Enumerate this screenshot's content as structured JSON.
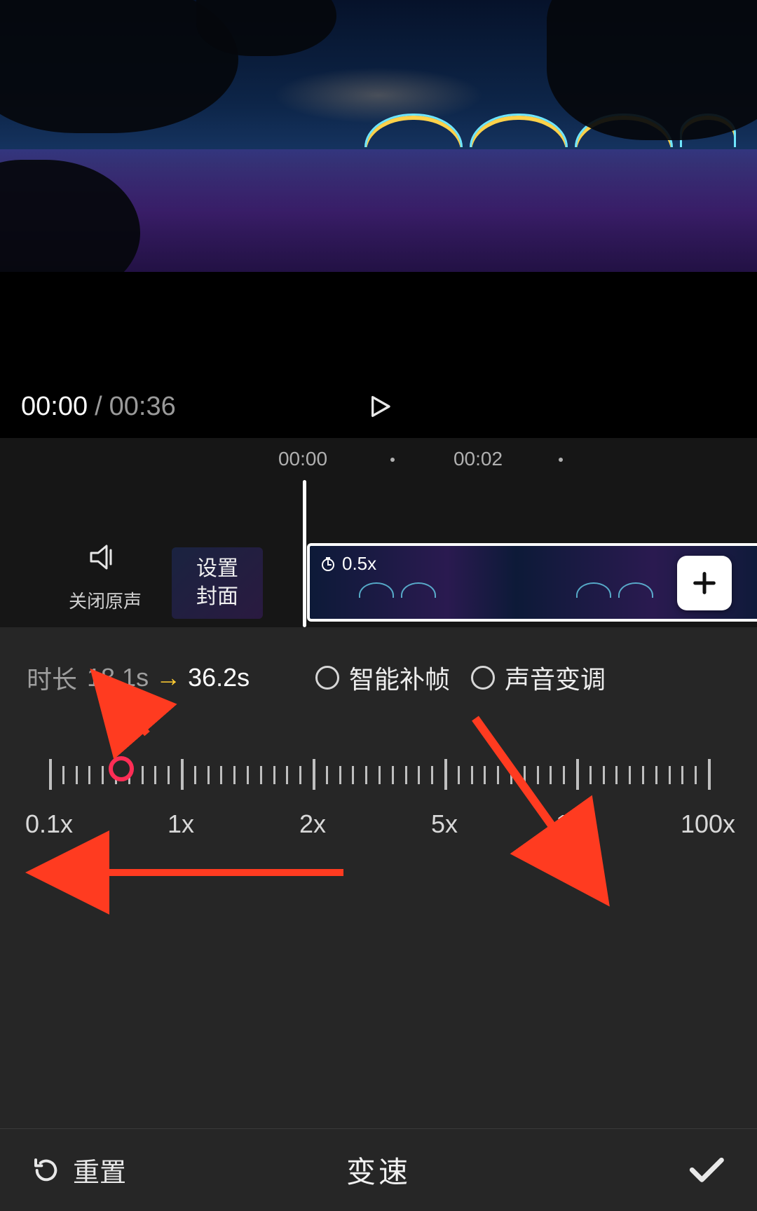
{
  "player": {
    "current_time": "00:00",
    "separator": "/",
    "total_time": "00:36"
  },
  "timeline": {
    "ruler": {
      "t0": "00:00",
      "t1": "00:02"
    },
    "mute_label": "关闭原声",
    "cover_label": "设置\n封面",
    "clip_badge": "0.5x"
  },
  "speed": {
    "duration_label": "时长",
    "from": "18.1s",
    "to": "36.2s",
    "option_interp": "智能补帧",
    "option_pitch": "声音变调",
    "marks": {
      "m0": "0.1x",
      "m1": "1x",
      "m2": "2x",
      "m3": "5x",
      "m4": "10x",
      "m5": "100x"
    }
  },
  "bottom": {
    "reset": "重置",
    "title": "变速"
  }
}
